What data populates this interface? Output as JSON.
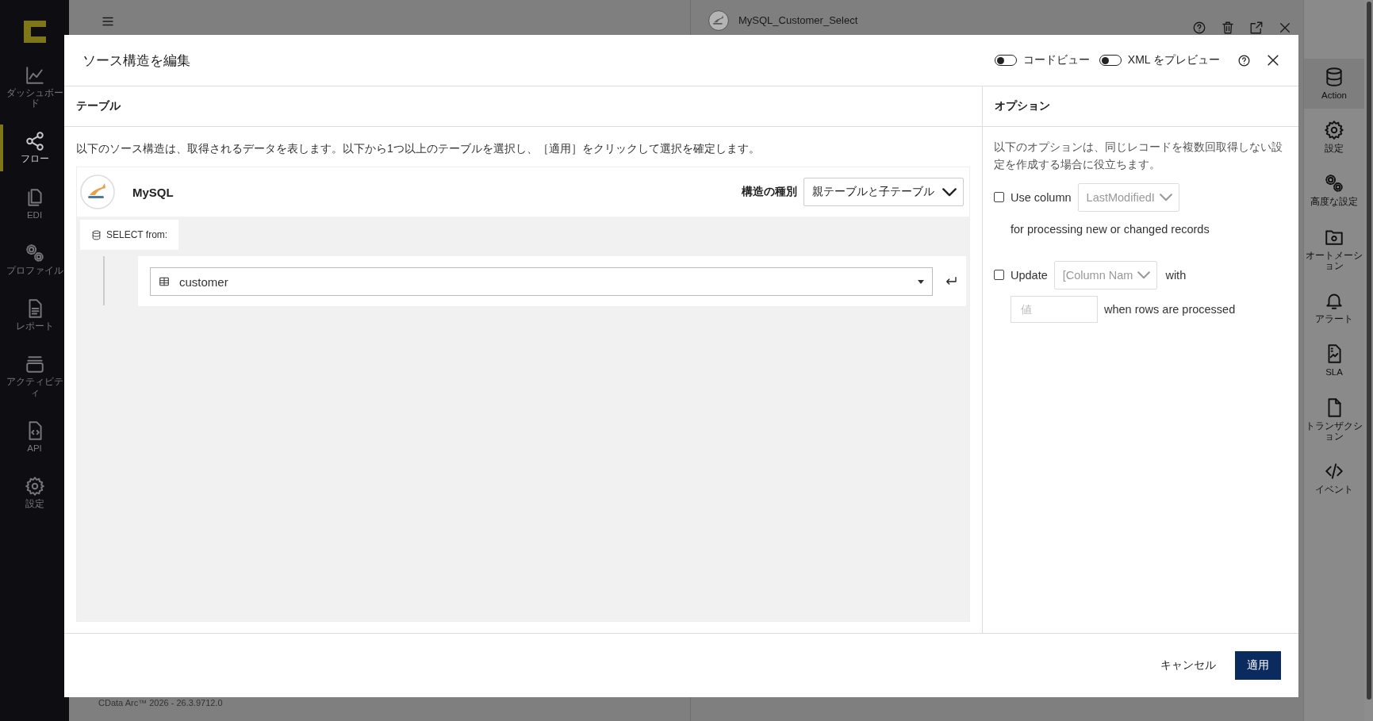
{
  "sidebar": [
    {
      "label": "ダッシュボード",
      "selected": false
    },
    {
      "label": "フロー",
      "selected": true
    },
    {
      "label": "EDI",
      "selected": false
    },
    {
      "label": "プロファイル",
      "selected": false
    },
    {
      "label": "レポート",
      "selected": false
    },
    {
      "label": "アクティビティ",
      "selected": false
    },
    {
      "label": "API",
      "selected": false
    },
    {
      "label": "設定",
      "selected": false
    }
  ],
  "version": "CData Arc™ 2026 - 26.3.9712.0",
  "flow_panel": {
    "title": "MySQL_Customer_Select"
  },
  "right_sidebar": [
    {
      "label": "Action",
      "selected": true
    },
    {
      "label": "設定",
      "selected": false
    },
    {
      "label": "高度な設定",
      "selected": false
    },
    {
      "label": "オートメーション",
      "selected": false
    },
    {
      "label": "アラート",
      "selected": false
    },
    {
      "label": "SLA",
      "selected": false
    },
    {
      "label": "トランザクション",
      "selected": false
    },
    {
      "label": "イベント",
      "selected": false
    }
  ],
  "dialog": {
    "title": "ソース構造を編集",
    "toggles": [
      {
        "label": "コードビュー",
        "on": false
      },
      {
        "label": "XML をプレビュー",
        "on": false
      }
    ],
    "tables_panel": {
      "heading": "テーブル",
      "description": "以下のソース構造は、取得されるデータを表します。以下から1つ以上のテーブルを選択し、［適用］をクリックして選択を確定します。",
      "source": {
        "name": "MySQL",
        "structure_label": "構造の種別",
        "structure_value": "親テーブルと子テーブル",
        "select_label": "SELECT from:",
        "table": "customer"
      }
    },
    "options_panel": {
      "heading": "オプション",
      "description": "以下のオプションは、同じレコードを複数回取得しない設定を作成する場合に役立ちます。",
      "use_column": {
        "checked": false,
        "label": "Use column",
        "column": "LastModifiedI",
        "note": "for processing new or changed records"
      },
      "update": {
        "checked": false,
        "label": "Update",
        "column": "[Column Nam",
        "with": "with",
        "value_placeholder": "値",
        "note": "when rows are processed"
      }
    },
    "buttons": [
      {
        "label": "キャンセル",
        "kind": "text"
      },
      {
        "label": "適用",
        "kind": "primary"
      }
    ]
  }
}
